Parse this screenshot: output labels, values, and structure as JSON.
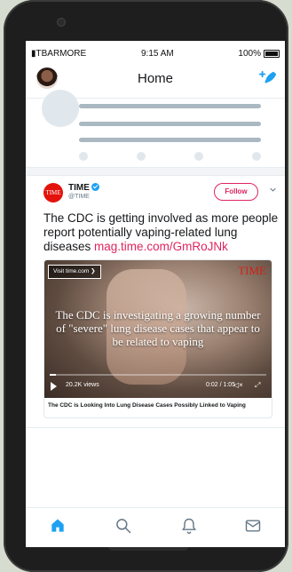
{
  "status_bar": {
    "carrier": "TBARMORE",
    "time": "9:15 AM",
    "battery": "100%"
  },
  "header": {
    "title": "Home"
  },
  "tweet": {
    "author_logo_text": "TIME",
    "author_name": "TIME",
    "handle": "@TIME",
    "follow_label": "Follow",
    "text": "The CDC is getting involved as more people report potentially vaping-related lung diseases ",
    "link": "mag.time.com/GmRoJNk",
    "media": {
      "visit_label": "Visit time.com",
      "brand": "TIME",
      "caption": "The CDC is investigating a growing number of \"severe\" lung disease cases that appear to be related to vaping",
      "views": "20.2K views",
      "duration": "0:02 / 1:05",
      "card_title": "The CDC is Looking Into Lung Disease Cases Possibly Linked to Vaping",
      "progress": 0.03
    }
  },
  "tabs": [
    "home-icon",
    "search-icon",
    "notifications-icon",
    "messages-icon"
  ],
  "colors": {
    "accent": "#1da1f2",
    "follow": "#e0245e",
    "time_red": "#e3120b"
  }
}
